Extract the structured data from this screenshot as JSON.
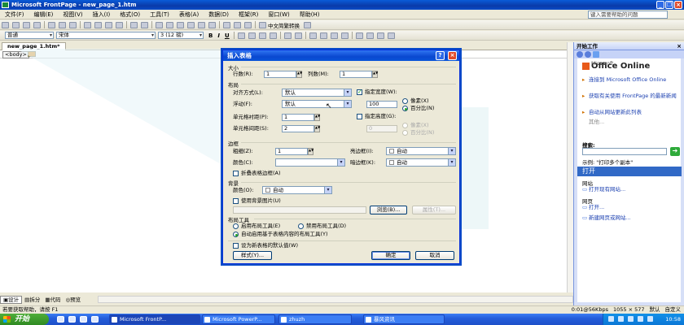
{
  "window": {
    "title": "Microsoft FrontPage - new_page_1.htm"
  },
  "menu": [
    "文件(F)",
    "编辑(E)",
    "视图(V)",
    "插入(I)",
    "格式(O)",
    "工具(T)",
    "表格(A)",
    "数据(D)",
    "框架(R)",
    "窗口(W)",
    "帮助(H)"
  ],
  "help_box": "键入需要帮助的问题",
  "toolbar": {
    "style_combo": "普通",
    "font_combo": "宋体",
    "size_combo": "3 (12 磅)",
    "ime_label": "中文简繁转换",
    "bold": "B",
    "italic": "I",
    "underline": "U"
  },
  "document": {
    "tab": "new_page_1.htm*",
    "tag": "<body>"
  },
  "view_tabs": [
    "设计",
    "拆分",
    "代码",
    "预览"
  ],
  "status": {
    "left": "若要获取帮助，请按 F1",
    "speed": "0:01@56Kbps",
    "size": "1055 × 577",
    "mode1": "默认",
    "mode2": "自定义"
  },
  "taskbar": {
    "start": "开始",
    "tasks": [
      "Microsoft FrontP...",
      "Microsoft PowerP...",
      "zhuzh",
      "暴风资讯"
    ],
    "clock": "10:58"
  },
  "task_pane": {
    "title": "开始工作",
    "logo_prefix": "Microsoft",
    "logo": "Office Online",
    "links": [
      "连接到 Microsoft Office Online",
      "获取有关使用 FrontPage 的最新新闻",
      "自动从网站更新此列表"
    ],
    "more": "其他...",
    "search_label": "搜索:",
    "example": "示例: \"打印多个副本\"",
    "open_header": "打开",
    "site_label": "网站",
    "open_site": "打开现有网站...",
    "page_label": "网页",
    "open_page": "打开...",
    "new_page": "新建网页或网站..."
  },
  "dialog": {
    "title": "插入表格",
    "size_group": "大小",
    "rows_label": "行数(R):",
    "rows_value": "1",
    "cols_label": "列数(M):",
    "cols_value": "1",
    "layout_group": "布局",
    "align_label": "对齐方式(L):",
    "align_value": "默认",
    "float_label": "浮动(F):",
    "float_value": "默认",
    "padding_label": "单元格衬距(P):",
    "padding_value": "1",
    "spacing_label": "单元格间距(S):",
    "spacing_value": "2",
    "width_check": "指定宽度(W):",
    "width_value": "100",
    "width_px": "像素(X)",
    "width_pct": "百分比(N)",
    "height_check": "指定高度(G):",
    "height_value": "0",
    "height_px": "像素(X)",
    "height_pct": "百分比(N)",
    "border_group": "边框",
    "border_size_label": "粗细(Z):",
    "border_size_value": "1",
    "border_color_label": "颜色(C):",
    "light_border_label": "亮边框(I):",
    "light_border_value": "自动",
    "dark_border_label": "暗边框(K):",
    "dark_border_value": "自动",
    "collapse_label": "折叠表格边框(A)",
    "bg_group": "背景",
    "bg_color_label": "颜色(O):",
    "bg_color_value": "自动",
    "bg_image_label": "使用背景图片(U)",
    "browse_btn": "浏览(B)...",
    "props_btn": "属性(T)...",
    "tools_group": "布局工具",
    "tool_enable": "启用布局工具(E)",
    "tool_disable": "禁用布局工具(D)",
    "tool_auto": "自动启用基于表格内容的布局工具(Y)",
    "default_label": "设为新表格的默认值(W)",
    "style_btn": "样式(Y)...",
    "ok_btn": "确定",
    "cancel_btn": "取消"
  }
}
